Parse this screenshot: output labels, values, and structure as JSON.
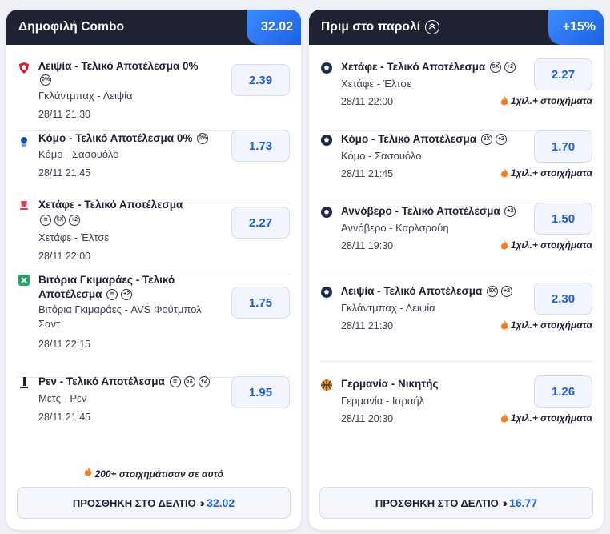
{
  "left_panel": {
    "title": "Δημοφιλή Combo",
    "badge": "32.02",
    "rows": [
      {
        "title": "Λειψία - Τελικό Αποτέλεσμα 0%",
        "teams": "Γκλάντμπαχ - Λειψία",
        "time": "28/11 21:30",
        "odds": "2.39",
        "icon": "team-crest-icon"
      },
      {
        "title": "Κόμο - Τελικό Αποτέλεσμα 0%",
        "teams": "Κόμο - Σασουόλο",
        "time": "28/11 21:45",
        "odds": "1.73",
        "icon": "league-logo-icon"
      },
      {
        "title": "Χετάφε - Τελικό Αποτέλεσμα",
        "teams": "Χετάφε - Έλτσε",
        "time": "28/11 22:00",
        "odds": "2.27",
        "icon": "laliga-logo-icon"
      },
      {
        "title_line1": "Βιτόρια Γκιμαράες - Τελικό",
        "title_line2": "Αποτέλεσμα",
        "teams_line1": "Βιτόρια Γκιμαράες - AVS Φούτμπολ",
        "teams_line2": "Σαντ",
        "time": "28/11 22:15",
        "odds": "1.75",
        "icon": "liga-portugal-logo-icon"
      },
      {
        "title": "Ρεν - Τελικό Αποτέλεσμα",
        "teams": "Μετς - Ρεν",
        "time": "28/11 21:45",
        "odds": "1.95",
        "icon": "ligue1-logo-icon"
      }
    ],
    "footer_note": "200+ στοιχημάτισαν σε αυτό",
    "add_label": "ΠΡΟΣΘΗΚΗ ΣΤΟ ΔΕΛΤΙΟ",
    "add_total": "32.02"
  },
  "right_panel": {
    "title": "Πριμ στο παρολί",
    "badge": "+15%",
    "rows": [
      {
        "title": "Χετάφε - Τελικό Αποτέλεσμα",
        "teams": "Χετάφε - Έλτσε",
        "time": "28/11 22:00",
        "odds": "2.27",
        "note": "1χιλ.+ στοιχήματα"
      },
      {
        "title": "Κόμο - Τελικό Αποτέλεσμα",
        "teams": "Κόμο - Σασουόλο",
        "time": "28/11 21:45",
        "odds": "1.70",
        "note": "1χιλ.+ στοιχήματα"
      },
      {
        "title": "Αννόβερο - Τελικό Αποτέλεσμα",
        "teams": "Αννόβερο - Καρλσρούη",
        "time": "28/11 19:30",
        "odds": "1.50",
        "note": "1χιλ.+ στοιχήματα"
      },
      {
        "title": "Λειψία - Τελικό Αποτέλεσμα",
        "teams": "Γκλάντμπαχ - Λειψία",
        "time": "28/11 21:30",
        "odds": "2.30",
        "note": "1χιλ.+ στοιχήματα"
      },
      {
        "title": "Γερμανία - Νικητής",
        "teams": "Γερμανία - Ισραήλ",
        "time": "28/11 20:30",
        "odds": "1.26",
        "note": "1χιλ.+ στοιχήματα"
      }
    ],
    "add_label": "ΠΡΟΣΘΗΚΗ ΣΤΟ ΔΕΛΤΙΟ",
    "add_total": "16.77"
  },
  "tags": {
    "zero_margin": "0%",
    "bet_builder": "≋",
    "cashout": "5X",
    "plus_two": "+2"
  },
  "colors": {
    "header_bg": "#1f2233",
    "accent_blue": "#1b5fdc",
    "flame": "#ff7a1a"
  }
}
